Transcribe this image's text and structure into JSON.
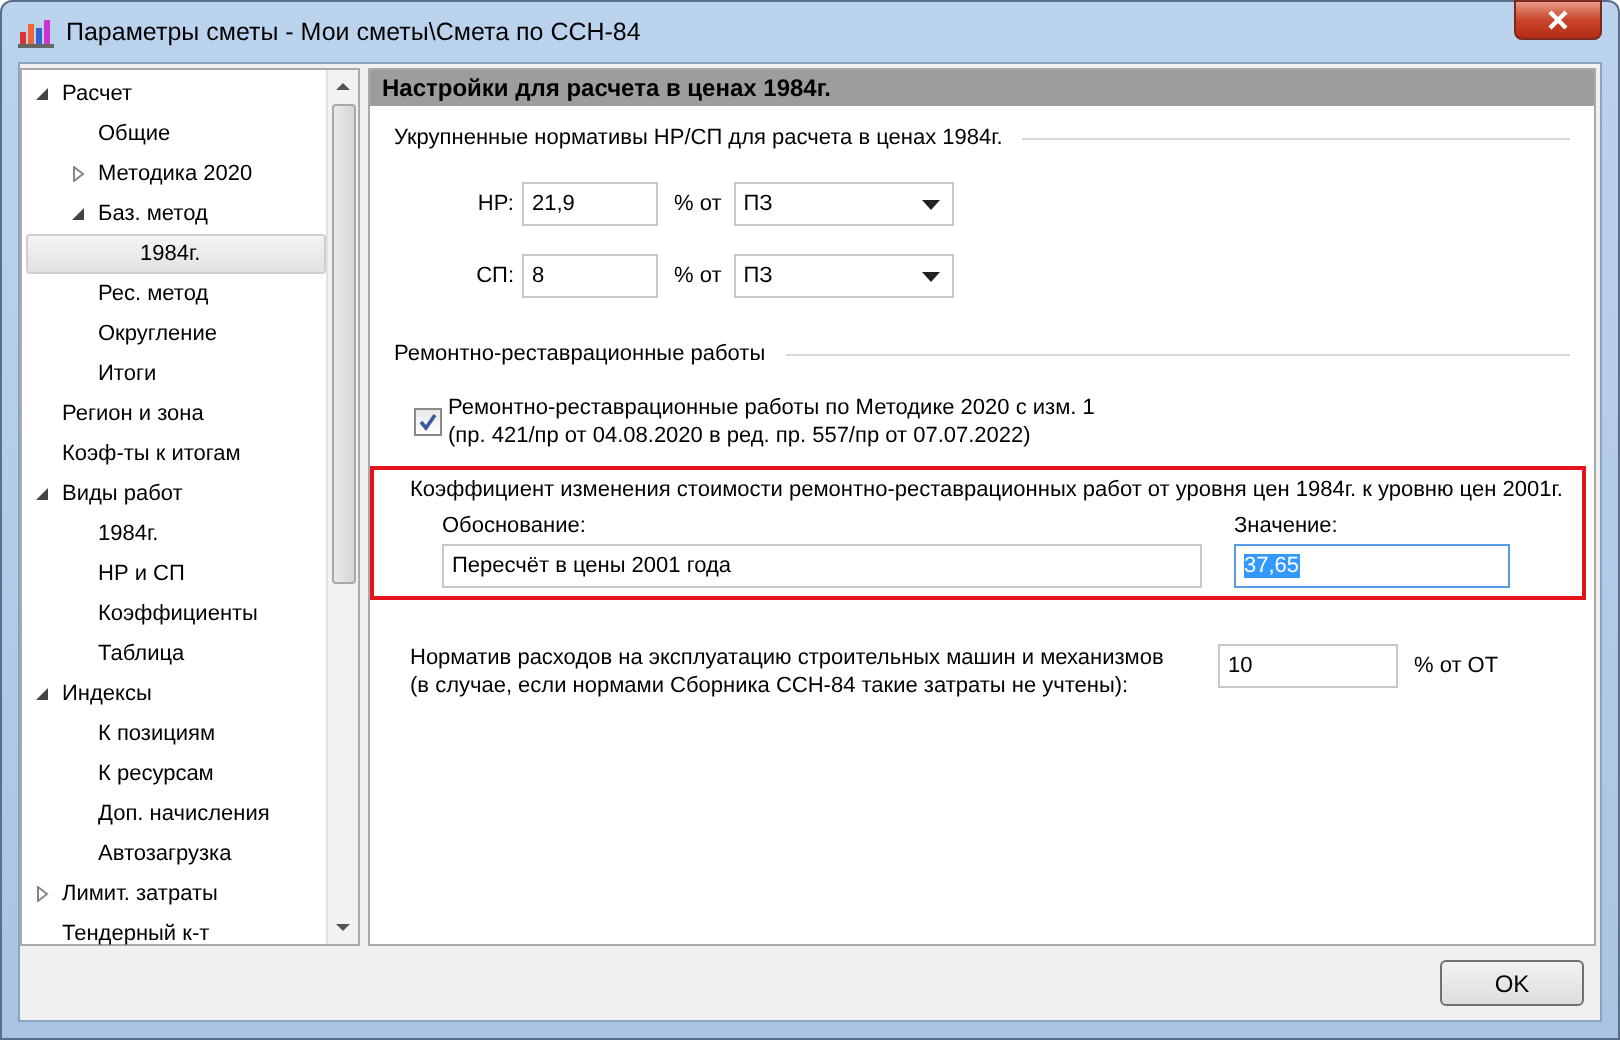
{
  "window": {
    "title": "Параметры сметы - Мои сметы\\Смета по ССН-84"
  },
  "tree": [
    {
      "label": "Расчет",
      "expanded": true,
      "selected": false,
      "children": [
        {
          "label": "Общие",
          "selected": false
        },
        {
          "label": "Методика 2020",
          "expanded": false,
          "selected": false
        },
        {
          "label": "Баз. метод",
          "expanded": true,
          "selected": false,
          "children": [
            {
              "label": "1984г.",
              "selected": true
            }
          ]
        },
        {
          "label": "Рес. метод",
          "selected": false
        },
        {
          "label": "Округление",
          "selected": false
        },
        {
          "label": "Итоги",
          "selected": false
        }
      ]
    },
    {
      "label": "Регион и зона",
      "selected": false
    },
    {
      "label": "Коэф-ты к итогам",
      "selected": false
    },
    {
      "label": "Виды работ",
      "expanded": true,
      "selected": false,
      "children": [
        {
          "label": "1984г.",
          "selected": false
        },
        {
          "label": "НР и СП",
          "selected": false
        },
        {
          "label": "Коэффициенты",
          "selected": false
        },
        {
          "label": "Таблица",
          "selected": false
        }
      ]
    },
    {
      "label": "Индексы",
      "expanded": true,
      "selected": false,
      "children": [
        {
          "label": "К позициям",
          "selected": false
        },
        {
          "label": "К ресурсам",
          "selected": false
        },
        {
          "label": "Доп. начисления",
          "selected": false
        },
        {
          "label": "Автозагрузка",
          "selected": false
        }
      ]
    },
    {
      "label": "Лимит. затраты",
      "expanded": false,
      "selected": false
    },
    {
      "label": "Тендерный к-т",
      "selected": false
    }
  ],
  "panel": {
    "header": "Настройки для расчета в ценах 1984г.",
    "group1": {
      "title": "Укрупненные нормативы НР/СП для расчета в ценах 1984г.",
      "rows": [
        {
          "label": "НР:",
          "value": "21,9",
          "unit": "% от",
          "select": "ПЗ"
        },
        {
          "label": "СП:",
          "value": "8",
          "unit": "% от",
          "select": "ПЗ"
        }
      ]
    },
    "group2": {
      "title": "Ремонтно-реставрационные работы",
      "checkbox": {
        "checked": true,
        "line1": "Ремонтно-реставрационные работы по Методике 2020 с изм. 1",
        "line2": "(пр. 421/пр от 04.08.2020 в ред. пр. 557/пр от 07.07.2022)"
      }
    },
    "coefficient": {
      "title": "Коэффициент изменения стоимости ремонтно-реставрационных работ от уровня цен 1984г. к уровню цен 2001г.",
      "basis_label": "Обоснование:",
      "basis": "Пересчёт в цены 2001 года",
      "value_label": "Значение:",
      "value": "37,65",
      "value_highlighted": true
    },
    "machines": {
      "line1": "Норматив расходов на эксплуатацию строительных машин и механизмов",
      "line2": "(в случае, если нормами Сборника ССН-84 такие затраты не учтены):",
      "value": "10",
      "unit": "% от ОТ"
    }
  },
  "buttons": [
    "OK"
  ]
}
